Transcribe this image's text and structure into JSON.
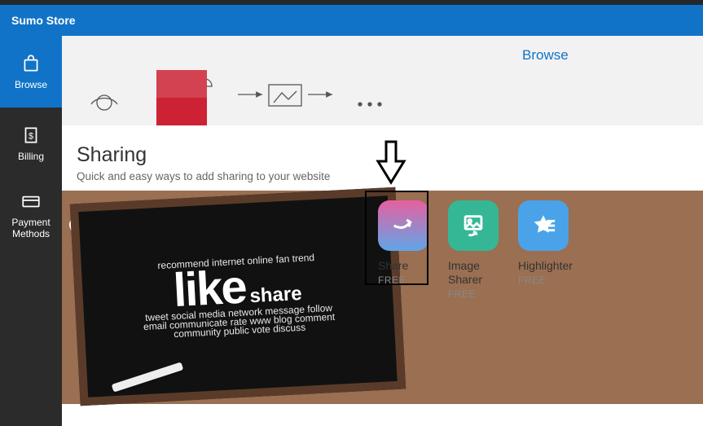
{
  "header": {
    "title": "Sumo Store"
  },
  "sidebar": {
    "items": [
      {
        "label": "Browse"
      },
      {
        "label": "Billing"
      },
      {
        "label": "Payment Methods"
      }
    ]
  },
  "topstrip": {
    "browse_link": "Browse"
  },
  "section": {
    "title": "Sharing",
    "subtitle": "Quick and easy ways to add sharing to your website"
  },
  "cards": [
    {
      "name": "Share",
      "price": "FREE"
    },
    {
      "name": "Image Sharer",
      "price": "FREE"
    },
    {
      "name": "Highlighter",
      "price": "FREE"
    }
  ],
  "wordcloud": [
    "share",
    "like",
    "social media",
    "follow",
    "vote",
    "comment",
    "www",
    "rate",
    "blog",
    "message",
    "discuss",
    "community",
    "public",
    "internet",
    "online",
    "tweet",
    "network",
    "email",
    "communicate",
    "fan",
    "trend",
    "recommend"
  ]
}
